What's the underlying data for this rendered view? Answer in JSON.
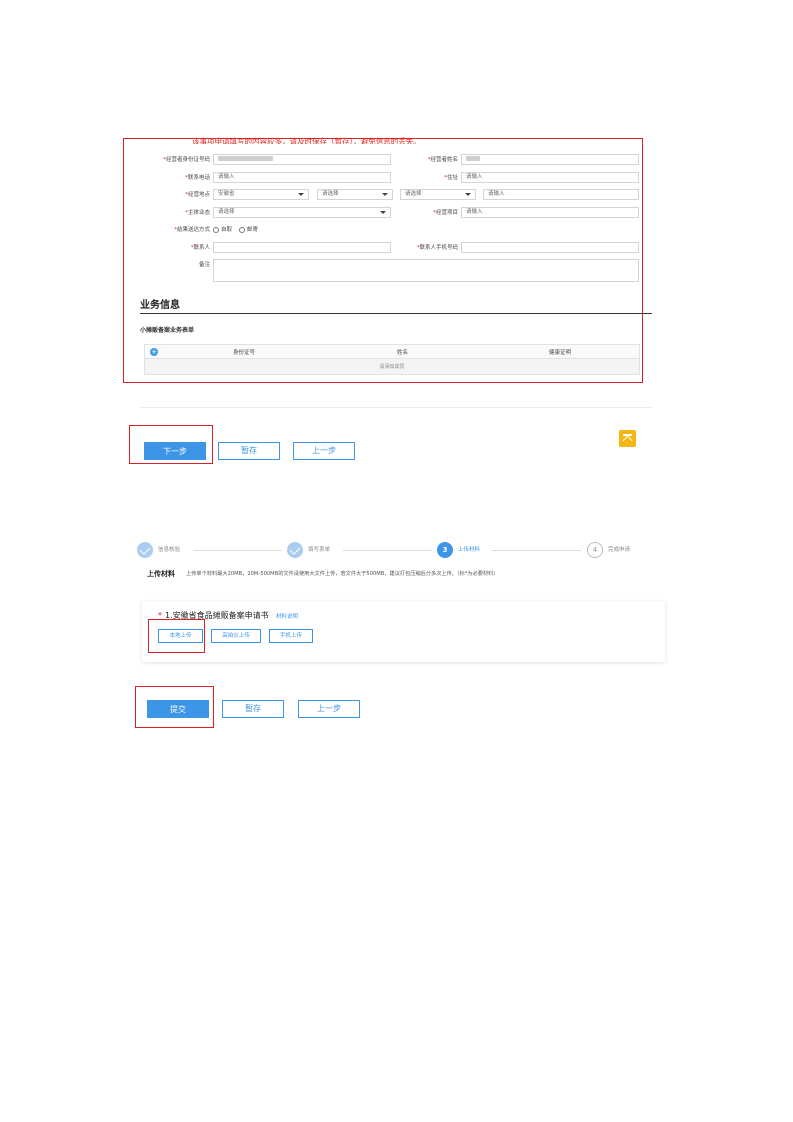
{
  "form": {
    "notice": "该事项申请填写的内容较多，请及时保存（暂存），避免信息的丢失。",
    "id_label": "经营者身份证号码",
    "name_label": "经营者姓名",
    "phone_label": "联系电话",
    "phone_placeholder": "请输入",
    "address_label": "住址",
    "address_placeholder": "请输入",
    "biz_location_label": "经营地点",
    "province_value": "安徽省",
    "city_placeholder": "请选择",
    "district_placeholder": "请选择",
    "detail_placeholder": "请输入",
    "subject_label": "主体业态",
    "subject_placeholder": "请选择",
    "biz_item_label": "经营项目",
    "biz_item_placeholder": "请输入",
    "delivery_label": "结果送达方式",
    "delivery_option1": "自取",
    "delivery_option2": "邮寄",
    "contact_label": "联系人",
    "contact_phone_label": "联系人手机号码",
    "remark_label": "备注"
  },
  "business": {
    "section_title": "业务信息",
    "sub_title": "小摊贩备案业务表单",
    "columns": [
      "身份证号",
      "姓名",
      "健康证明"
    ],
    "add_member": "请添加成员"
  },
  "page1_buttons": {
    "next": "下一步",
    "save": "暂存",
    "prev": "上一步"
  },
  "steps": [
    {
      "num": "1",
      "label": "信息核验",
      "state": "done"
    },
    {
      "num": "2",
      "label": "填写表单",
      "state": "done"
    },
    {
      "num": "3",
      "label": "上传材料",
      "state": "active"
    },
    {
      "num": "4",
      "label": "完成申请",
      "state": "todo"
    }
  ],
  "upload": {
    "title": "上传材料",
    "hint": "上传单个材料最大20MB，20M-500MB的文件请使用大文件上传，若文件大于500MB，建议打包压缩后分多次上传。（标*为必要材料）",
    "material_title": "1.安徽省食品摊贩备案申请书",
    "material_link": "材料说明",
    "local_upload": "本地上传",
    "scanner_upload": "高拍仪上传",
    "phone_upload": "手机上传"
  },
  "page2_buttons": {
    "submit": "提交",
    "save": "暂存",
    "prev": "上一步"
  },
  "colors": {
    "primary": "#3c95e6",
    "highlight_red": "#e02020",
    "backtop": "#f5b614"
  }
}
